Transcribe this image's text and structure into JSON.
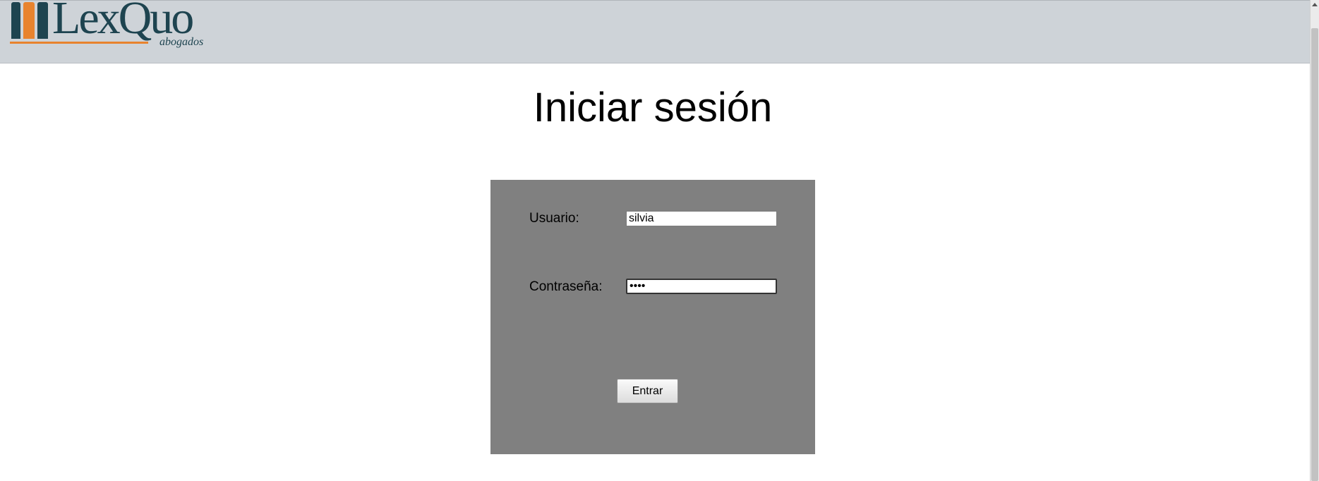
{
  "header": {
    "logo_text": "LexQuo",
    "logo_subtext": "abogados"
  },
  "page": {
    "title": "Iniciar sesión"
  },
  "login_form": {
    "username_label": "Usuario:",
    "username_value": "silvia",
    "password_label": "Contraseña:",
    "password_value": "••••",
    "submit_label": "Entrar"
  },
  "colors": {
    "header_bg": "#ced3d8",
    "logo_primary": "#1e4450",
    "logo_accent": "#e8832e",
    "form_bg": "#808080"
  }
}
